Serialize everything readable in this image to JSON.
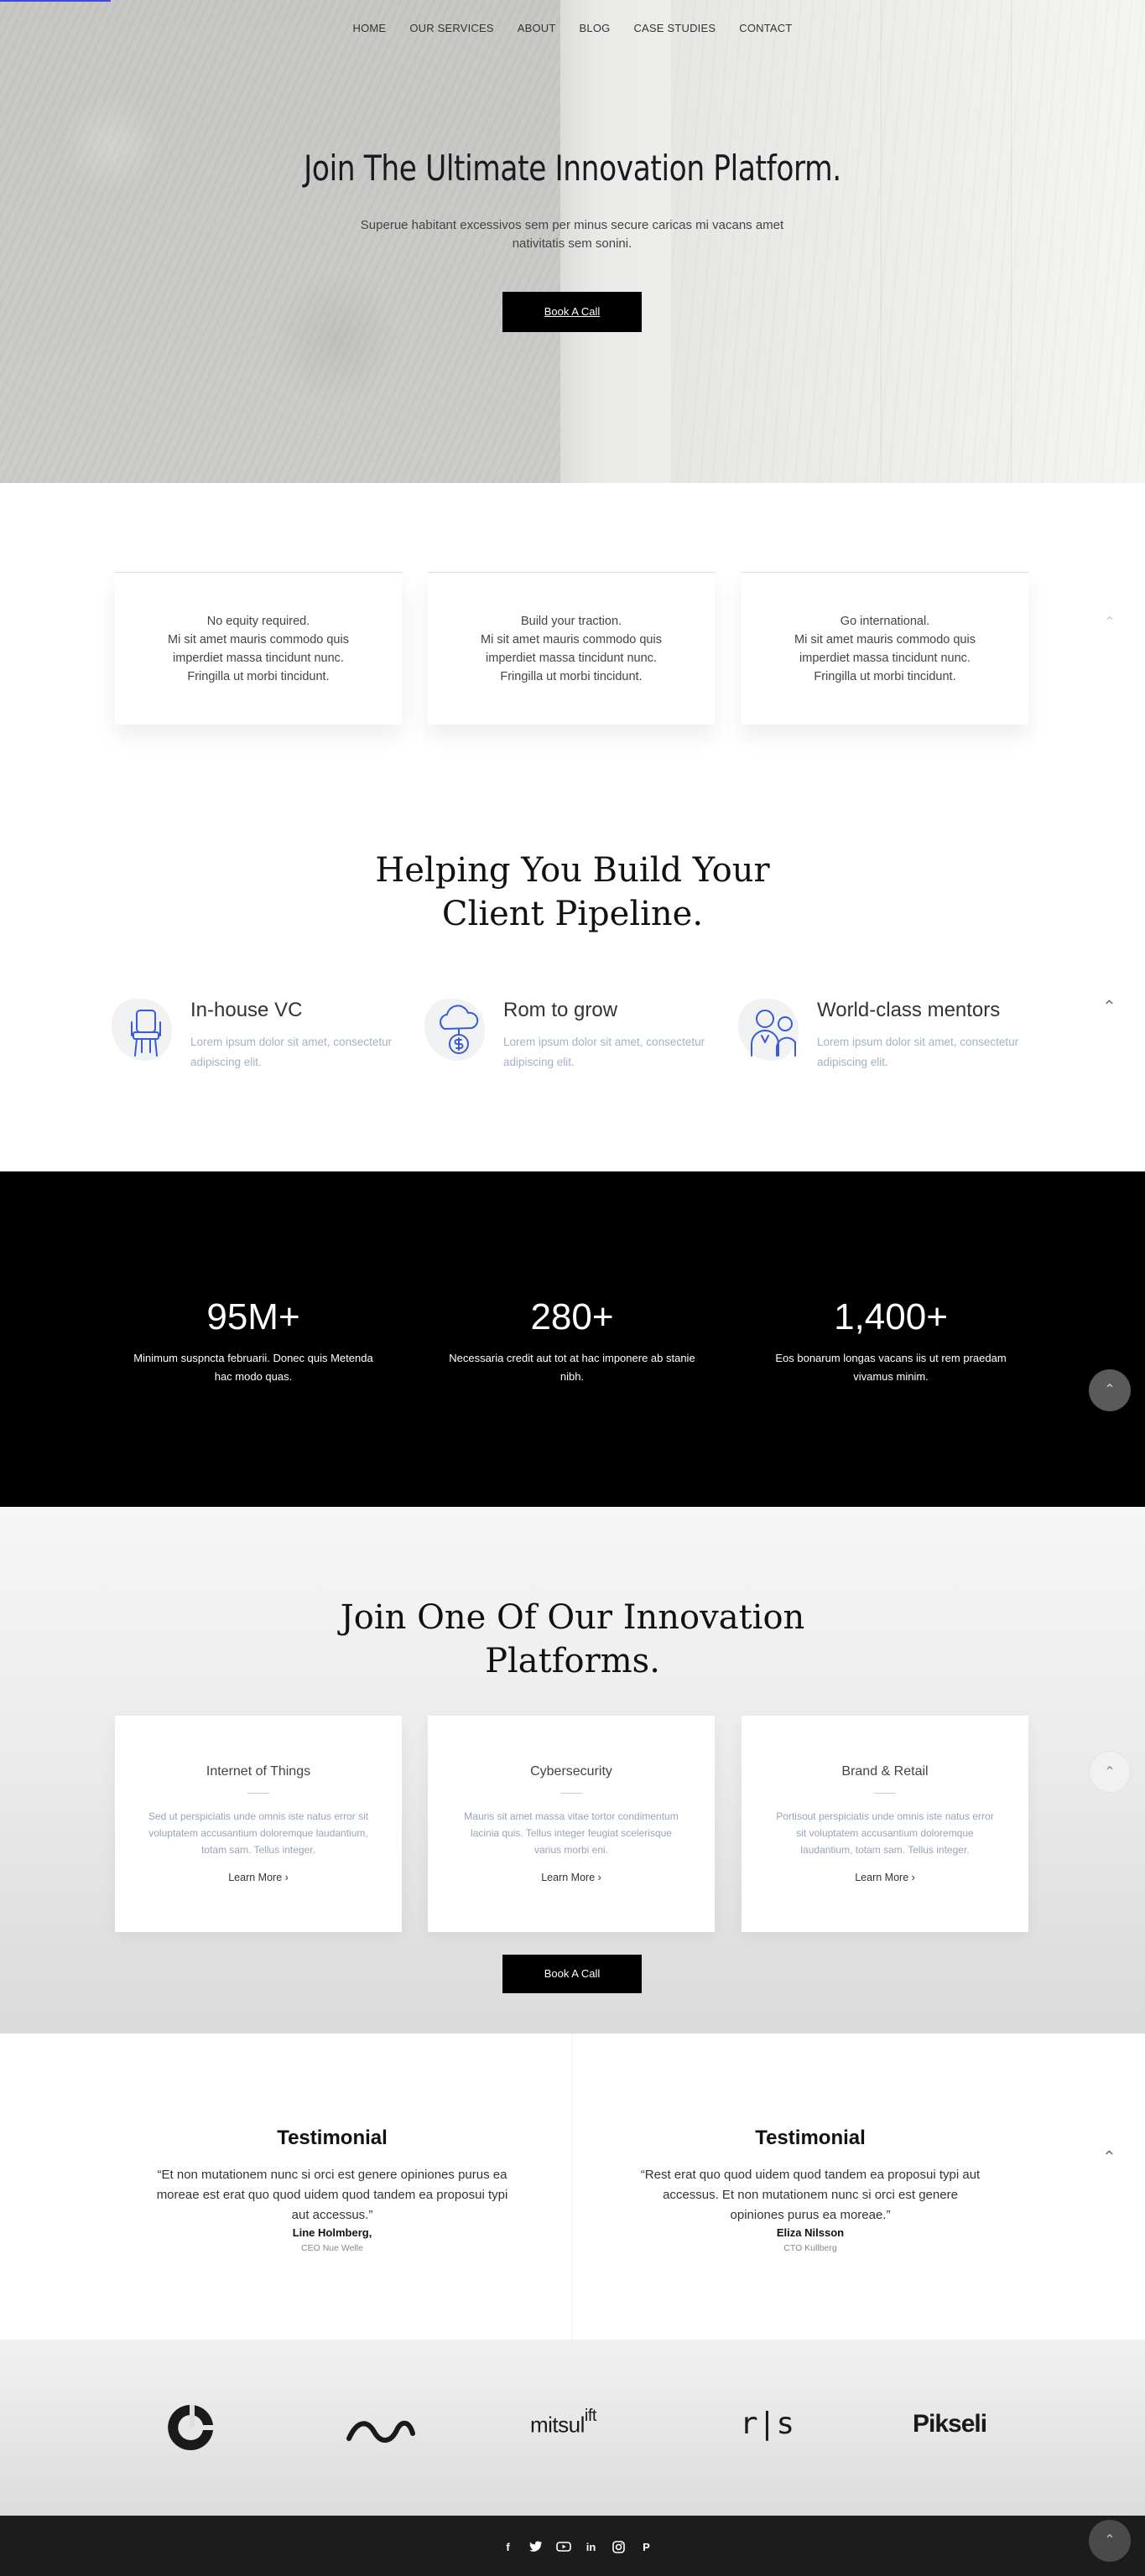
{
  "nav": {
    "items": [
      "HOME",
      "OUR SERVICES",
      "ABOUT",
      "BLOG",
      "CASE STUDIES",
      "CONTACT"
    ]
  },
  "hero": {
    "title": "Join The Ultimate Innovation Platform.",
    "subtitle": "Superue habitant excessivos sem per minus secure caricas mi vacans amet nativitatis sem sonini.",
    "cta": "Book A Call"
  },
  "features": [
    {
      "lines": [
        "No equity required.",
        "Mi sit amet mauris commodo quis",
        "imperdiet massa tincidunt nunc.",
        "Fringilla ut morbi tincidunt."
      ]
    },
    {
      "lines": [
        "Build your traction.",
        "Mi sit amet mauris commodo quis",
        "imperdiet massa tincidunt nunc.",
        "Fringilla ut morbi tincidunt."
      ]
    },
    {
      "lines": [
        "Go international.",
        "Mi sit amet mauris commodo quis",
        "imperdiet massa tincidunt nunc.",
        "Fringilla ut morbi tincidunt."
      ]
    }
  ],
  "pipeline": {
    "title_line1": "Helping You Build Your",
    "title_line2": "Client Pipeline.",
    "items": [
      {
        "title": "In-house VC",
        "desc": "Lorem ipsum dolor sit amet, consectetur adipiscing elit.",
        "icon": "chair-icon"
      },
      {
        "title": "Rom to grow",
        "desc": "Lorem ipsum dolor sit amet, consectetur adipiscing elit.",
        "icon": "cloud-money-icon"
      },
      {
        "title": "World-class mentors",
        "desc": "Lorem ipsum dolor sit amet, consectetur adipiscing elit.",
        "icon": "mentors-icon"
      }
    ]
  },
  "stats": [
    {
      "value": "95M+",
      "caption": "Minimum suspncta februarii. Donec quis Metenda hac modo quas."
    },
    {
      "value": "280+",
      "caption": "Necessaria credit aut tot at hac imponere ab stanie nibh."
    },
    {
      "value": "1,400+",
      "caption": "Eos bonarum longas vacans iis ut rem praedam vivamus minim."
    }
  ],
  "platforms": {
    "title_line1": "Join One Of Our Innovation",
    "title_line2": "Platforms.",
    "cards": [
      {
        "title": "Internet of Things",
        "text": "Sed ut perspiciatis unde omnis iste natus error sit voluptatem accusantium doloremque laudantium, totam sam. Tellus integer.",
        "more": "Learn More  ›"
      },
      {
        "title": "Cybersecurity",
        "text": "Mauris sit amet massa vitae tortor condimentum lacinia quis. Tellus integer feugiat scelerisque varius morbi eni.",
        "more": "Learn More  ›"
      },
      {
        "title": "Brand & Retail",
        "text": "Portisout perspiciatis unde omnis iste natus error sit voluptatem accusantium doloremque laudantium, totam sam. Tellus integer.",
        "more": "Learn More  ›"
      }
    ],
    "cta": "Book A Call"
  },
  "testimonials": [
    {
      "heading": "Testimonial",
      "quote": "“Et non mutationem nunc si orci est genere opiniones purus ea moreae est erat quo quod uidem quod tandem ea proposui typi aut accessus.”",
      "name": "Line Holmberg,",
      "role": "CEO Nue Welle"
    },
    {
      "heading": "Testimonial",
      "quote": "“Rest erat quo quod uidem quod tandem ea proposui typi aut accessus. Et non mutationem nunc si orci est genere opiniones purus ea moreae.”",
      "name": "Eliza Nilsson",
      "role": "CTO Kullberg"
    }
  ],
  "logos": {
    "mitsulift_main": "mitsul",
    "mitsulift_sup": "ift",
    "rs": "r|s",
    "pikseli": "Pikseli"
  },
  "social": [
    "facebook-icon",
    "twitter-icon",
    "youtube-icon",
    "linkedin-icon",
    "instagram-icon",
    "pinterest-icon"
  ],
  "social_glyphs": {
    "facebook": "f",
    "linkedin": "in",
    "pinterest": "P"
  },
  "colors": {
    "accent_blue": "#3b5bd6",
    "muted_text": "#a6b0c8",
    "dark": "#000000",
    "footer": "#1c1c1c"
  }
}
